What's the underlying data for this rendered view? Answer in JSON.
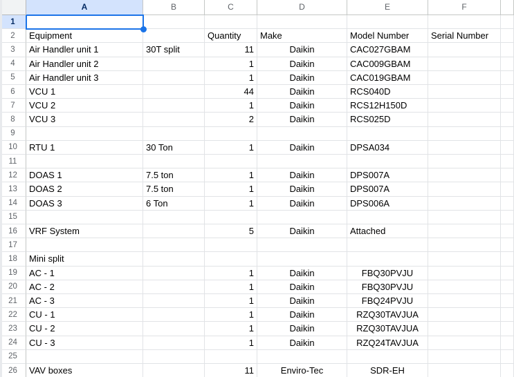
{
  "sheet": {
    "column_letters": [
      "A",
      "B",
      "C",
      "D",
      "E",
      "F"
    ],
    "selection": {
      "cell": "A1",
      "column": "A",
      "row": 1,
      "value": ""
    },
    "colors": {
      "selection_blue": "#1a73e8",
      "selected_header_bg": "#d3e3fd",
      "gridline": "#e1e3e6",
      "header_text": "#5f6368",
      "cell_text": "#000000"
    },
    "rows": [
      {
        "n": 1,
        "cells": []
      },
      {
        "n": 2,
        "cells": [
          {
            "col": "A",
            "text": "Equipment"
          },
          {
            "col": "C",
            "text": "Quantity"
          },
          {
            "col": "D",
            "text": "Make"
          },
          {
            "col": "E",
            "text": "Model Number"
          },
          {
            "col": "F",
            "text": "Serial Number"
          }
        ]
      },
      {
        "n": 3,
        "cells": [
          {
            "col": "A",
            "text": "Air Handler unit 1"
          },
          {
            "col": "B",
            "text": "30T split"
          },
          {
            "col": "C",
            "text": "11",
            "align": "right"
          },
          {
            "col": "D",
            "text": "Daikin",
            "align": "center"
          },
          {
            "col": "E",
            "text": "CAC027GBAM"
          }
        ]
      },
      {
        "n": 4,
        "cells": [
          {
            "col": "A",
            "text": "Air Handler unit 2"
          },
          {
            "col": "C",
            "text": "1",
            "align": "right"
          },
          {
            "col": "D",
            "text": "Daikin",
            "align": "center"
          },
          {
            "col": "E",
            "text": "CAC009GBAM"
          }
        ]
      },
      {
        "n": 5,
        "cells": [
          {
            "col": "A",
            "text": "Air Handler unit 3"
          },
          {
            "col": "C",
            "text": "1",
            "align": "right"
          },
          {
            "col": "D",
            "text": "Daikin",
            "align": "center"
          },
          {
            "col": "E",
            "text": "CAC019GBAM"
          }
        ]
      },
      {
        "n": 6,
        "cells": [
          {
            "col": "A",
            "text": "VCU 1"
          },
          {
            "col": "C",
            "text": "44",
            "align": "right"
          },
          {
            "col": "D",
            "text": "Daikin",
            "align": "center"
          },
          {
            "col": "E",
            "text": "RCS040D"
          }
        ]
      },
      {
        "n": 7,
        "cells": [
          {
            "col": "A",
            "text": "VCU 2"
          },
          {
            "col": "C",
            "text": "1",
            "align": "right"
          },
          {
            "col": "D",
            "text": "Daikin",
            "align": "center"
          },
          {
            "col": "E",
            "text": "RCS12H150D"
          }
        ]
      },
      {
        "n": 8,
        "cells": [
          {
            "col": "A",
            "text": "VCU 3"
          },
          {
            "col": "C",
            "text": "2",
            "align": "right"
          },
          {
            "col": "D",
            "text": "Daikin",
            "align": "center"
          },
          {
            "col": "E",
            "text": "RCS025D"
          }
        ]
      },
      {
        "n": 9,
        "cells": []
      },
      {
        "n": 10,
        "cells": [
          {
            "col": "A",
            "text": "RTU 1"
          },
          {
            "col": "B",
            "text": "30 Ton"
          },
          {
            "col": "C",
            "text": "1",
            "align": "right"
          },
          {
            "col": "D",
            "text": "Daikin",
            "align": "center"
          },
          {
            "col": "E",
            "text": "DPSA034"
          }
        ]
      },
      {
        "n": 11,
        "cells": []
      },
      {
        "n": 12,
        "cells": [
          {
            "col": "A",
            "text": "DOAS 1"
          },
          {
            "col": "B",
            "text": "7.5 ton"
          },
          {
            "col": "C",
            "text": "1",
            "align": "right"
          },
          {
            "col": "D",
            "text": "Daikin",
            "align": "center"
          },
          {
            "col": "E",
            "text": "DPS007A"
          }
        ]
      },
      {
        "n": 13,
        "cells": [
          {
            "col": "A",
            "text": "DOAS 2"
          },
          {
            "col": "B",
            "text": "7.5 ton"
          },
          {
            "col": "C",
            "text": "1",
            "align": "right"
          },
          {
            "col": "D",
            "text": "Daikin",
            "align": "center"
          },
          {
            "col": "E",
            "text": "DPS007A"
          }
        ]
      },
      {
        "n": 14,
        "cells": [
          {
            "col": "A",
            "text": "DOAS 3"
          },
          {
            "col": "B",
            "text": "6 Ton"
          },
          {
            "col": "C",
            "text": "1",
            "align": "right"
          },
          {
            "col": "D",
            "text": "Daikin",
            "align": "center"
          },
          {
            "col": "E",
            "text": "DPS006A"
          }
        ]
      },
      {
        "n": 15,
        "cells": []
      },
      {
        "n": 16,
        "cells": [
          {
            "col": "A",
            "text": "VRF System"
          },
          {
            "col": "C",
            "text": "5",
            "align": "right"
          },
          {
            "col": "D",
            "text": "Daikin",
            "align": "center"
          },
          {
            "col": "E",
            "text": "Attached"
          }
        ]
      },
      {
        "n": 17,
        "cells": []
      },
      {
        "n": 18,
        "cells": [
          {
            "col": "A",
            "text": "Mini split"
          }
        ]
      },
      {
        "n": 19,
        "cells": [
          {
            "col": "A",
            "text": "AC - 1"
          },
          {
            "col": "C",
            "text": "1",
            "align": "right"
          },
          {
            "col": "D",
            "text": "Daikin",
            "align": "center"
          },
          {
            "col": "E",
            "text": "FBQ30PVJU",
            "align": "center"
          }
        ]
      },
      {
        "n": 20,
        "cells": [
          {
            "col": "A",
            "text": "AC - 2"
          },
          {
            "col": "C",
            "text": "1",
            "align": "right"
          },
          {
            "col": "D",
            "text": "Daikin",
            "align": "center"
          },
          {
            "col": "E",
            "text": "FBQ30PVJU",
            "align": "center"
          }
        ]
      },
      {
        "n": 21,
        "cells": [
          {
            "col": "A",
            "text": "AC - 3"
          },
          {
            "col": "C",
            "text": "1",
            "align": "right"
          },
          {
            "col": "D",
            "text": "Daikin",
            "align": "center"
          },
          {
            "col": "E",
            "text": "FBQ24PVJU",
            "align": "center"
          }
        ]
      },
      {
        "n": 22,
        "cells": [
          {
            "col": "A",
            "text": "CU - 1"
          },
          {
            "col": "C",
            "text": "1",
            "align": "right"
          },
          {
            "col": "D",
            "text": "Daikin",
            "align": "center"
          },
          {
            "col": "E",
            "text": "RZQ30TAVJUA",
            "align": "center"
          }
        ]
      },
      {
        "n": 23,
        "cells": [
          {
            "col": "A",
            "text": "CU - 2"
          },
          {
            "col": "C",
            "text": "1",
            "align": "right"
          },
          {
            "col": "D",
            "text": "Daikin",
            "align": "center"
          },
          {
            "col": "E",
            "text": "RZQ30TAVJUA",
            "align": "center"
          }
        ]
      },
      {
        "n": 24,
        "cells": [
          {
            "col": "A",
            "text": "CU - 3"
          },
          {
            "col": "C",
            "text": "1",
            "align": "right"
          },
          {
            "col": "D",
            "text": "Daikin",
            "align": "center"
          },
          {
            "col": "E",
            "text": "RZQ24TAVJUA",
            "align": "center"
          }
        ]
      },
      {
        "n": 25,
        "cells": []
      },
      {
        "n": 26,
        "cells": [
          {
            "col": "A",
            "text": "VAV boxes"
          },
          {
            "col": "C",
            "text": "11",
            "align": "right"
          },
          {
            "col": "D",
            "text": "Enviro-Tec",
            "align": "center"
          },
          {
            "col": "E",
            "text": "SDR-EH",
            "align": "center"
          }
        ]
      }
    ]
  }
}
